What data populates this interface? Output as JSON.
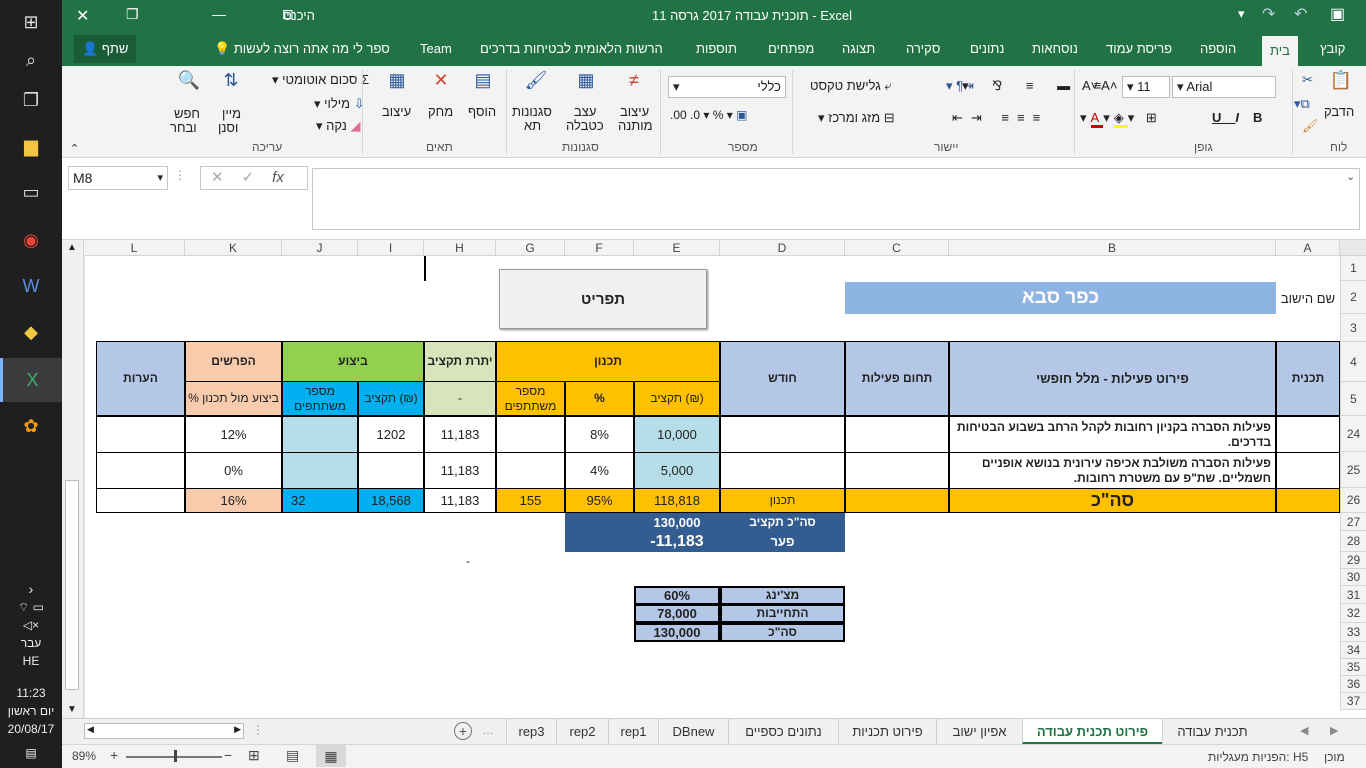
{
  "taskbar": {
    "time": "11:23",
    "day": "יום ראשון",
    "date": "20/08/17",
    "lang1": "עבר",
    "lang2": "HE"
  },
  "title": {
    "text": "תוכנית עבודה 2017 גרסה 11  -  Excel",
    "signin": "היכנס"
  },
  "tabs": [
    "קובץ",
    "בית",
    "הוספה",
    "פריסת עמוד",
    "נוסחאות",
    "נתונים",
    "סקירה",
    "תצוגה",
    "מפתחים",
    "תוספות",
    "הרשות הלאומית לבטיחות בדרכים",
    "Team"
  ],
  "tellme": "ספר לי מה אתה רוצה לעשות",
  "share": "שתף",
  "ribbon": {
    "clipboard": {
      "paste": "הדבק",
      "group": "לוח"
    },
    "font": {
      "name": "Arial",
      "size": "11",
      "group": "גופן"
    },
    "align": {
      "wrap": "גלישת טקסט",
      "merge": "מזג ומרכז",
      "group": "יישור"
    },
    "number": {
      "format": "כללי",
      "group": "מספר"
    },
    "styles": {
      "cond1": "עיצוב",
      "cond2": "מותנה",
      "table1": "עצב",
      "table2": "כטבלה",
      "cell1": "סגנונות",
      "cell2": "תא",
      "group": "סגנונות"
    },
    "cells": {
      "insert": "הוסף",
      "delete": "מחק",
      "format": "עיצוב",
      "group": "תאים"
    },
    "edit": {
      "autosum": "סכום אוטומטי",
      "fill": "מילוי",
      "clear": "נקה",
      "sort1": "מיין",
      "sort2": "וסנן",
      "find1": "חפש",
      "find2": "ובחר",
      "group": "עריכה"
    }
  },
  "formula": {
    "namebox": "M8",
    "fx": "fx",
    "value": ""
  },
  "columns": [
    "A",
    "B",
    "C",
    "D",
    "E",
    "F",
    "G",
    "H",
    "I",
    "J",
    "K",
    "L"
  ],
  "rows": [
    "1",
    "2",
    "3",
    "4",
    "5",
    "24",
    "25",
    "26",
    "27",
    "28",
    "29",
    "30",
    "31",
    "32",
    "33",
    "34",
    "35",
    "36",
    "37"
  ],
  "cells": {
    "settlement_label": "שם הישוב",
    "settlement": "כפר סבא",
    "detail_btn": "תפריט",
    "h_program": "תכנית",
    "h_detail": "פירוט פעילות - מלל חופשי",
    "h_domain": "תחום פעילות",
    "h_month": "חודש",
    "h_plan": "תכנון",
    "h_budget_plan": "תקציב (₪)",
    "h_pct": "%",
    "h_participants_plan": "מספר משתתפים",
    "h_balance": "יתרת תקציב",
    "h_balance_dash": "-",
    "h_exec": "ביצוע",
    "h_budget_exec": "תקציב (₪)",
    "h_participants_exec": "מספר משתתפים",
    "h_diff": "הפרשים",
    "h_diff_sub": "% ביצוע מול תכנון",
    "h_notes": "הערות",
    "r24_b": "פעילות הסברה בקניון רחובות לקהל הרחב בשבוע הבטיחות בדרכים.",
    "r24_e": "10,000",
    "r24_f": "8%",
    "r24_h": "11,183",
    "r24_i": "1202",
    "r24_k": "12%",
    "r25_b": "פעילות הסברה משולבת אכיפה עירונית בנושא אופניים חשמליים. שת\"פ עם משטרת רחובות.",
    "r25_e": "5,000",
    "r25_f": "4%",
    "r25_h": "11,183",
    "r25_k": "0%",
    "r26_b": "סה\"כ",
    "r26_d": "תכנון",
    "r26_e": "118,818",
    "r26_f": "95%",
    "r26_g": "155",
    "r26_h": "11,183",
    "r26_i": "18,568",
    "r26_j": "32",
    "r26_k": "16%",
    "r27_d": "סה\"כ תקציב",
    "r27_e": "130,000",
    "r28_d": "פער",
    "r28_e": "-11,183",
    "r29_h": "-",
    "r31_d": "מצ'ינג",
    "r31_e": "60%",
    "r32_d": "התחייבות",
    "r32_e": "78,000",
    "r33_d": "סה\"כ",
    "r33_e": "130,000"
  },
  "sheets": [
    "תכנית עבודה",
    "פירוט תכנית עבודה",
    "אפיון ישוב",
    "פירוט תכניות",
    "נתונים כספיים",
    "DBnew",
    "rep1",
    "rep2",
    "rep3"
  ],
  "status": {
    "ready": "מוכן",
    "access": "הפניות מעגליות: H5",
    "zoom": "89%"
  },
  "colors": {
    "excel_green": "#217346",
    "header_blue": "#b4c7e7",
    "plan_orange": "#ffc000",
    "exec_green": "#92d050",
    "exec_cyan": "#00b0f0",
    "diff_peach": "#f8cbad",
    "balance_light": "#d8e4bc",
    "total_navy": "#335d91",
    "settle_blue": "#8eb4e3"
  }
}
